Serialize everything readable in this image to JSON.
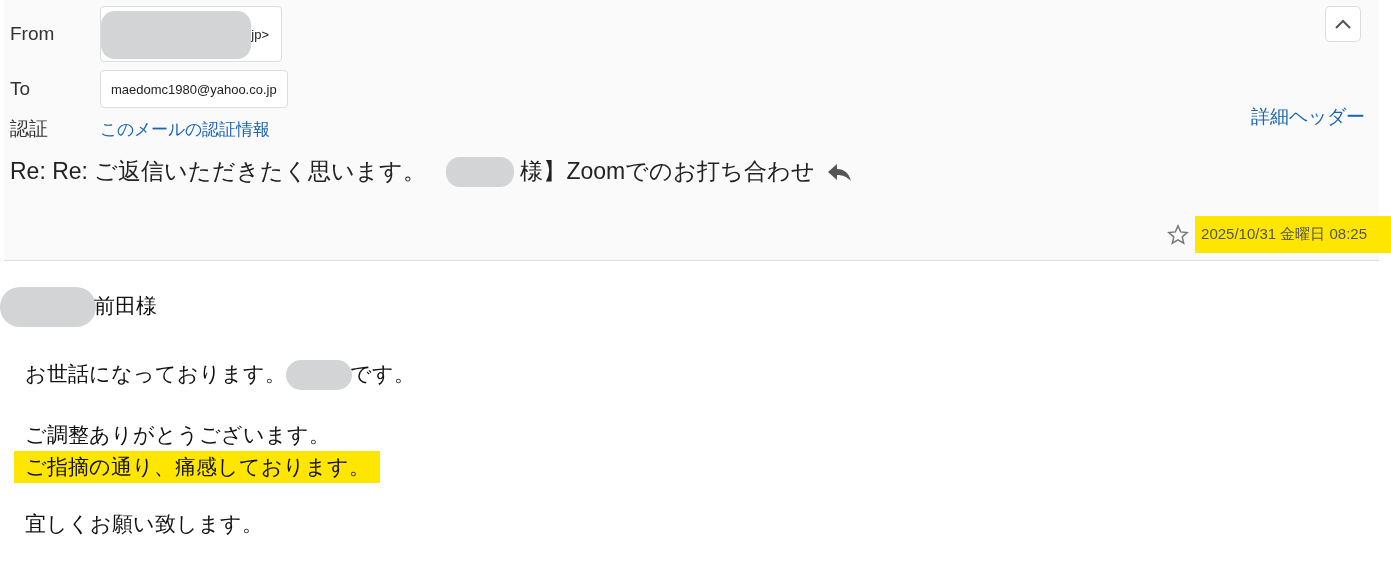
{
  "header": {
    "from": {
      "label": "From",
      "segments": [
        {
          "kind": "redaction"
        },
        {
          "kind": "text",
          "text": "jp>"
        }
      ]
    },
    "to": {
      "label": "To",
      "value": "maedomc1980@yahoo.co.jp"
    },
    "auth": {
      "label": "認証",
      "link": "このメールの認証情報"
    },
    "details_link": "詳細ヘッダー",
    "subject": {
      "segments": [
        {
          "kind": "text",
          "text": "Re: Re: ご返信いただきたく思います。"
        },
        {
          "kind": "redaction"
        },
        {
          "kind": "text",
          "text": "様】Zoomでのお打ち合わせ"
        }
      ]
    },
    "starred": false,
    "date": {
      "text": "2025/10/31 金曜日 08:25",
      "highlighted": true
    }
  },
  "body": [
    {
      "indent": false,
      "lines": [
        {
          "highlighted": false,
          "segments": [
            {
              "kind": "redaction"
            },
            {
              "kind": "text",
              "text": "前田様"
            }
          ]
        }
      ]
    },
    {
      "indent": true,
      "lines": [
        {
          "highlighted": false,
          "segments": [
            {
              "kind": "text",
              "text": "お世話になっております。"
            },
            {
              "kind": "redaction"
            },
            {
              "kind": "text",
              "text": "です。"
            }
          ]
        }
      ]
    },
    {
      "indent": true,
      "lines": [
        {
          "highlighted": false,
          "segments": [
            {
              "kind": "text",
              "text": "ご調整ありがとうございます。"
            }
          ]
        },
        {
          "highlighted": true,
          "segments": [
            {
              "kind": "text",
              "text": "ご指摘の通り、痛感しております。"
            }
          ]
        }
      ]
    },
    {
      "indent": true,
      "lines": [
        {
          "highlighted": false,
          "segments": [
            {
              "kind": "text",
              "text": "宜しくお願い致します。"
            }
          ]
        }
      ]
    }
  ]
}
